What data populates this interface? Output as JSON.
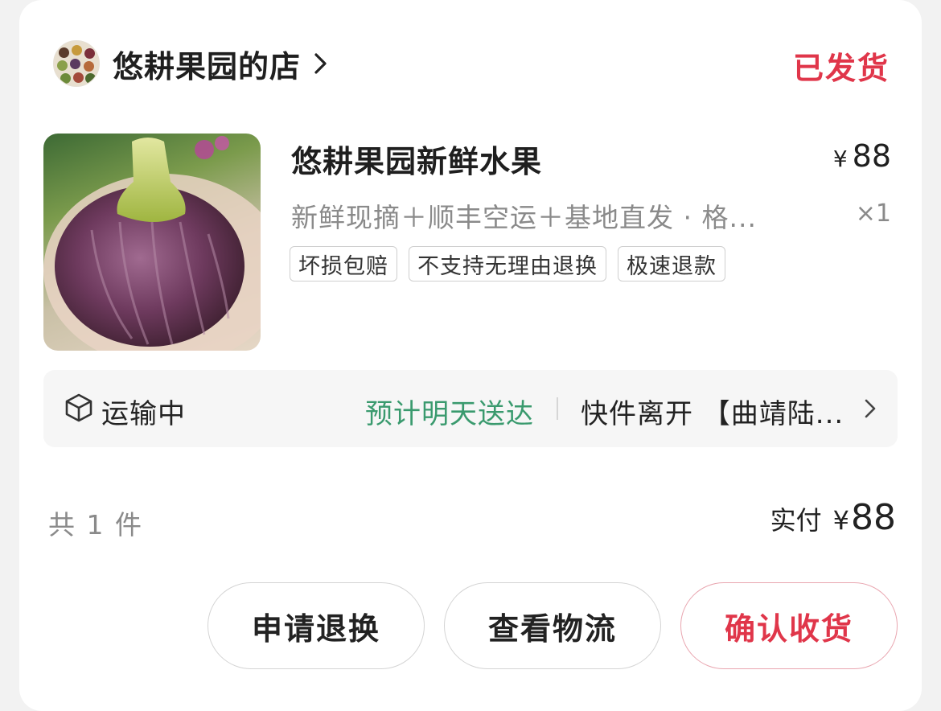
{
  "store": {
    "name": "悠耕果园的店",
    "status": "已发货",
    "status_color": "#e0364a"
  },
  "product": {
    "title": "悠耕果园新鲜水果",
    "currency": "¥",
    "price": "88",
    "spec": "新鲜现摘＋顺丰空运＋基地直发 · 格...",
    "quantity": "×1",
    "tags": [
      "坏损包赔",
      "不支持无理由退换",
      "极速退款"
    ]
  },
  "logistics": {
    "icon": "package-icon",
    "state": "运输中",
    "eta": "预计明天送达",
    "eta_color": "#3a9a6e",
    "detail": "快件离开 【曲靖陆..."
  },
  "summary": {
    "count": "共 1 件",
    "paid_label": "实付",
    "currency": "¥",
    "amount": "88"
  },
  "actions": {
    "refund": "申请退换",
    "track": "查看物流",
    "confirm": "确认收货"
  }
}
